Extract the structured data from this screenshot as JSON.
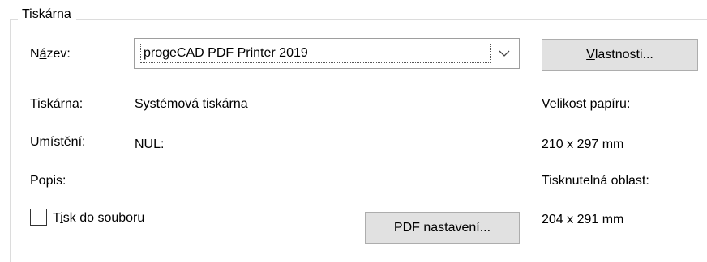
{
  "group": {
    "title": "Tiskárna"
  },
  "name": {
    "label_pre": "N",
    "label_accel": "á",
    "label_post": "zev:",
    "combo_value": "progeCAD PDF Printer 2019",
    "arrow_icon": "chevron-down-icon"
  },
  "properties_button": {
    "accel": "V",
    "rest": "lastnosti..."
  },
  "printer": {
    "label": "Tiskárna:",
    "value": "Systémová tiskárna"
  },
  "location": {
    "label": "Umístění:",
    "value": "NUL:"
  },
  "description": {
    "label": "Popis:",
    "value": ""
  },
  "print_to_file": {
    "checked": false,
    "label_pre": "T",
    "label_accel": "i",
    "label_post": "sk do souboru"
  },
  "pdf_settings_button": {
    "label": "PDF nastavení..."
  },
  "paper": {
    "size_label": "Velikost papíru:",
    "size_value": "210 x 297 mm",
    "printable_label": "Tisknutelná oblast:",
    "printable_value": "204 x 291 mm"
  }
}
